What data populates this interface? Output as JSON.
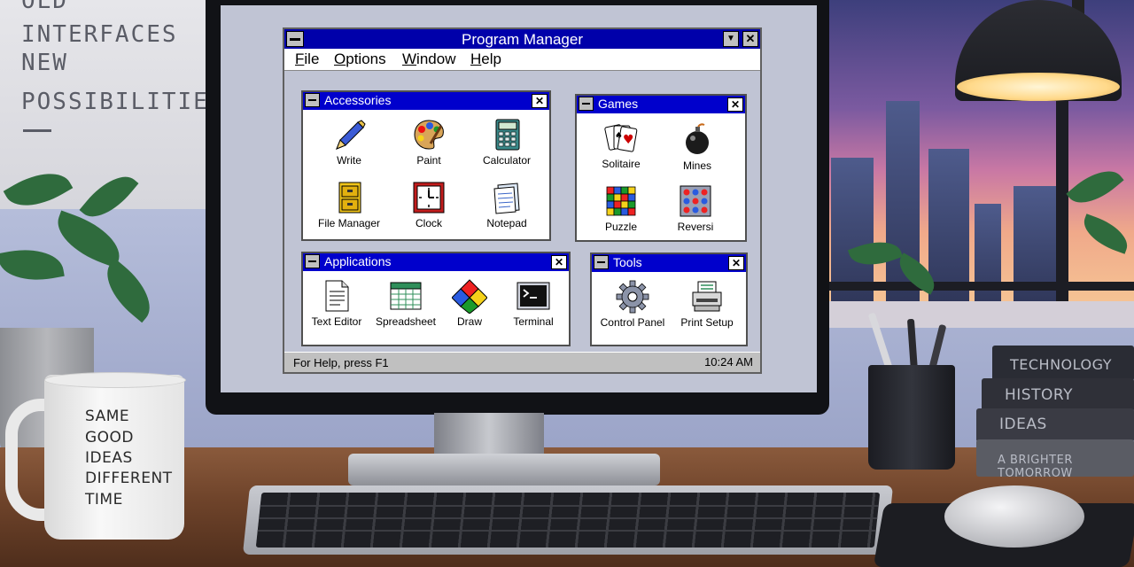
{
  "scene": {
    "poster_lines": [
      "OLD",
      "INTERFACES",
      "NEW",
      "POSSIBILITIES"
    ],
    "mug_lines": [
      "SAME",
      "GOOD",
      "IDEAS",
      "DIFFERENT",
      "TIME"
    ],
    "books": [
      "TECHNOLOGY",
      "HISTORY",
      "IDEAS",
      "A BRIGHTER TOMORROW"
    ]
  },
  "window": {
    "title": "Program Manager",
    "minimize_glyph": "▼",
    "close_glyph": "✕"
  },
  "menu": [
    "File",
    "Options",
    "Window",
    "Help"
  ],
  "groups": {
    "accessories": {
      "title": "Accessories",
      "items": [
        "Write",
        "Paint",
        "Calculator",
        "File Manager",
        "Clock",
        "Notepad"
      ]
    },
    "games": {
      "title": "Games",
      "items": [
        "Solitaire",
        "Mines",
        "Puzzle",
        "Reversi"
      ]
    },
    "applications": {
      "title": "Applications",
      "items": [
        "Text Editor",
        "Spreadsheet",
        "Draw",
        "Terminal"
      ]
    },
    "tools": {
      "title": "Tools",
      "items": [
        "Control Panel",
        "Print Setup"
      ]
    }
  },
  "status": {
    "help": "For Help, press F1",
    "time": "10:24 AM"
  },
  "icons": {
    "write": "pen-icon",
    "paint": "palette-icon",
    "calculator": "calculator-icon",
    "file_manager": "file-cabinet-icon",
    "clock": "clock-icon",
    "notepad": "notepad-icon",
    "solitaire": "cards-icon",
    "mines": "bomb-icon",
    "puzzle": "puzzle-grid-icon",
    "reversi": "reversi-icon",
    "text_editor": "document-icon",
    "spreadsheet": "spreadsheet-icon",
    "draw": "draw-shapes-icon",
    "terminal": "terminal-icon",
    "control_panel": "gear-icon",
    "print_setup": "printer-icon"
  },
  "colors": {
    "title_bar": "#0000aa",
    "group_title_bar": "#0000cc",
    "workspace": "#c0c4d4"
  }
}
